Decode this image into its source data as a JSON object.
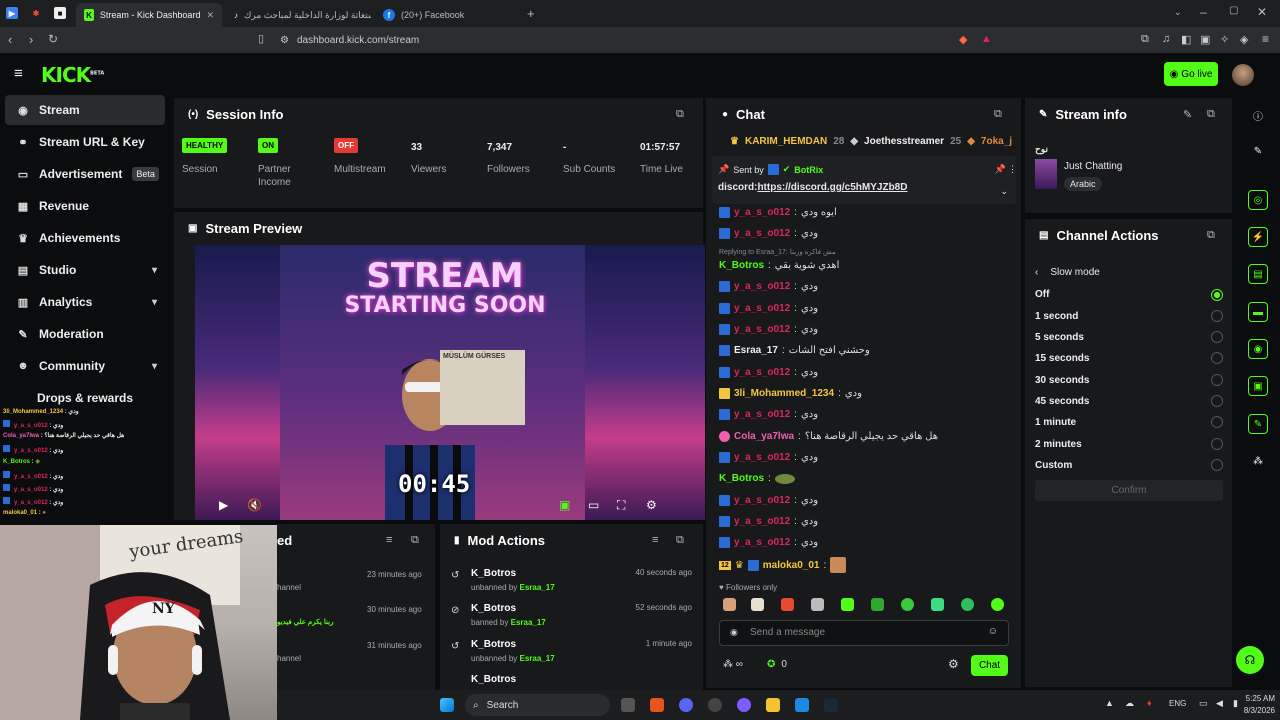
{
  "browser": {
    "tabs": [
      {
        "label": "Stream - Kick Dashboard",
        "active": true
      },
      {
        "label": "استغاثة لوزارة الداخلية لمباحث مرك"
      },
      {
        "label": "(20+) Facebook"
      }
    ],
    "url": "dashboard.kick.com/stream"
  },
  "header": {
    "logo": "KICK",
    "beta": "BETA",
    "go_live": "Go live"
  },
  "sidebar": {
    "items": [
      {
        "label": "Stream",
        "icon": "broadcast-icon",
        "active": true
      },
      {
        "label": "Stream URL & Key",
        "icon": "link-icon"
      },
      {
        "label": "Advertisement",
        "icon": "monitor-icon",
        "badge": "Beta"
      },
      {
        "label": "Revenue",
        "icon": "bar-chart-icon"
      },
      {
        "label": "Achievements",
        "icon": "trophy-icon"
      },
      {
        "label": "Studio",
        "icon": "studio-icon",
        "chevron": true
      },
      {
        "label": "Analytics",
        "icon": "analytics-icon",
        "chevron": true
      },
      {
        "label": "Moderation",
        "icon": "wrench-icon"
      },
      {
        "label": "Community",
        "icon": "people-icon",
        "chevron": true
      },
      {
        "label": "Drops & rewards",
        "icon": "gift-icon"
      }
    ]
  },
  "session": {
    "title": "Session Info",
    "stats": [
      {
        "badge": "HEALTHY",
        "badge_color": "#53fc18",
        "label": "Session"
      },
      {
        "badge": "ON",
        "badge_color": "#53fc18",
        "label": "Partner Income"
      },
      {
        "badge": "OFF",
        "badge_color": "#e53935",
        "label": "Multistream"
      },
      {
        "value": "33",
        "label": "Viewers"
      },
      {
        "value": "7,347",
        "label": "Followers"
      },
      {
        "value": "-",
        "label": "Sub Counts"
      },
      {
        "value": "01:57:57",
        "label": "Time Live"
      }
    ]
  },
  "preview": {
    "title": "Stream Preview",
    "line1": "STREAM",
    "line2": "STARTING SOON",
    "timer": "00:45",
    "poster": "MÜSLÜM GÜRSES"
  },
  "chat": {
    "title": "Chat",
    "top_gifters": [
      {
        "name": "KARIM_HEMDAN",
        "count": "28"
      },
      {
        "name": "Joethesstreamer",
        "count": "25"
      },
      {
        "name": "7oka_j"
      }
    ],
    "pinned": {
      "sent_by_label": "Sent by",
      "sender": "BotRix",
      "text": "discord:",
      "link": "https://discord.gg/c5hMYJZb8D"
    },
    "messages": [
      {
        "user": "y_a_s_o012",
        "color": "#e0245e",
        "text": "ايوه ودي"
      },
      {
        "user": "y_a_s_o012",
        "color": "#e0245e",
        "text": "ودي"
      },
      {
        "reply": "Replying to Esraa_17: مش فاكره وربنا"
      },
      {
        "user": "K_Botros",
        "color": "#53fc18",
        "text": "اهدي شوية بقي"
      },
      {
        "user": "y_a_s_o012",
        "color": "#e0245e",
        "text": "ودي"
      },
      {
        "user": "y_a_s_o012",
        "color": "#e0245e",
        "text": "ودي"
      },
      {
        "user": "y_a_s_o012",
        "color": "#e0245e",
        "text": "ودي"
      },
      {
        "user": "Esraa_17",
        "color": "#eee",
        "text": "وحشني افتح الشات"
      },
      {
        "user": "y_a_s_o012",
        "color": "#e0245e",
        "text": "ودي"
      },
      {
        "user": "3li_Mohammed_1234",
        "color": "#f5c542",
        "text": "ودي"
      },
      {
        "user": "y_a_s_o012",
        "color": "#e0245e",
        "text": "ودي"
      },
      {
        "user": "Cola_ya7lwa",
        "color": "#f05fb0",
        "text": "هل هاقي حد يجيلي الرقاصة هنا؟"
      },
      {
        "user": "y_a_s_o012",
        "color": "#e0245e",
        "text": "ودي"
      },
      {
        "user": "K_Botros",
        "color": "#53fc18",
        "text": ""
      },
      {
        "user": "y_a_s_o012",
        "color": "#e0245e",
        "text": "ودي"
      },
      {
        "user": "y_a_s_o012",
        "color": "#e0245e",
        "text": "ودي"
      },
      {
        "user": "y_a_s_o012",
        "color": "#e0245e",
        "text": "ودي"
      },
      {
        "user": "maloka0_01",
        "color": "#f5c542",
        "text": "",
        "badge": "12"
      }
    ],
    "followers_only": "Followers only",
    "placeholder": "Send a message",
    "count": "0",
    "send_label": "Chat"
  },
  "stream_info": {
    "title": "Stream info",
    "stream_title": "نوح",
    "category": "Just Chatting",
    "tag": "Arabic"
  },
  "channel_actions": {
    "title": "Channel Actions",
    "back_label": "Slow mode",
    "options": [
      "Off",
      "1 second",
      "5 seconds",
      "15 seconds",
      "30 seconds",
      "45 seconds",
      "1 minute",
      "2 minutes",
      "Custom"
    ],
    "selected": "Off",
    "confirm": "Confirm"
  },
  "mod_actions": {
    "title": "Mod Actions",
    "rows": [
      {
        "user": "K_Botros",
        "action": "unbanned by",
        "by": "Esraa_17",
        "ago": "40 seconds ago"
      },
      {
        "user": "K_Botros",
        "action": "banned by",
        "by": "Esraa_17",
        "ago": "52 seconds ago"
      },
      {
        "user": "K_Botros",
        "action": "unbanned by",
        "by": "Esraa_17",
        "ago": "1 minute ago"
      },
      {
        "user": "K_Botros"
      }
    ]
  },
  "activity": {
    "title": "ed",
    "rows": [
      {
        "ago": "23 minutes ago",
        "text": "hannel"
      },
      {
        "ago": "30 minutes ago",
        "text": "ربنا يكرم علي فيديو"
      },
      {
        "ago": "31 minutes ago",
        "text": "hannel"
      }
    ]
  },
  "overlay_chat": [
    {
      "user": "3li_Mohammed_1234",
      "text": "ودي",
      "color": "#f5c542"
    },
    {
      "user": "y_a_s_o012",
      "text": "ودي",
      "color": "#e0245e"
    },
    {
      "user": "Cola_ya7lwa",
      "text": "هل هاقي حد يجيلي الرقاصة هنا؟",
      "color": "#f05fb0"
    },
    {
      "user": "y_a_s_o012",
      "text": "ودي",
      "color": "#e0245e"
    },
    {
      "user": "K_Botros",
      "text": "",
      "color": "#53fc18"
    },
    {
      "user": "y_a_s_o012",
      "text": "ودي",
      "color": "#e0245e"
    },
    {
      "user": "y_a_s_o012",
      "text": "ودي",
      "color": "#e0245e"
    },
    {
      "user": "y_a_s_o012",
      "text": "ودي",
      "color": "#e0245e"
    },
    {
      "user": "maloka0_01",
      "text": "",
      "color": "#f5c542"
    }
  ],
  "taskbar": {
    "search": "Search",
    "lang": "ENG",
    "time": "5:25 AM",
    "date": "8/3/2026"
  },
  "colors": {
    "accent": "#53fc18",
    "panel": "#18191b"
  }
}
